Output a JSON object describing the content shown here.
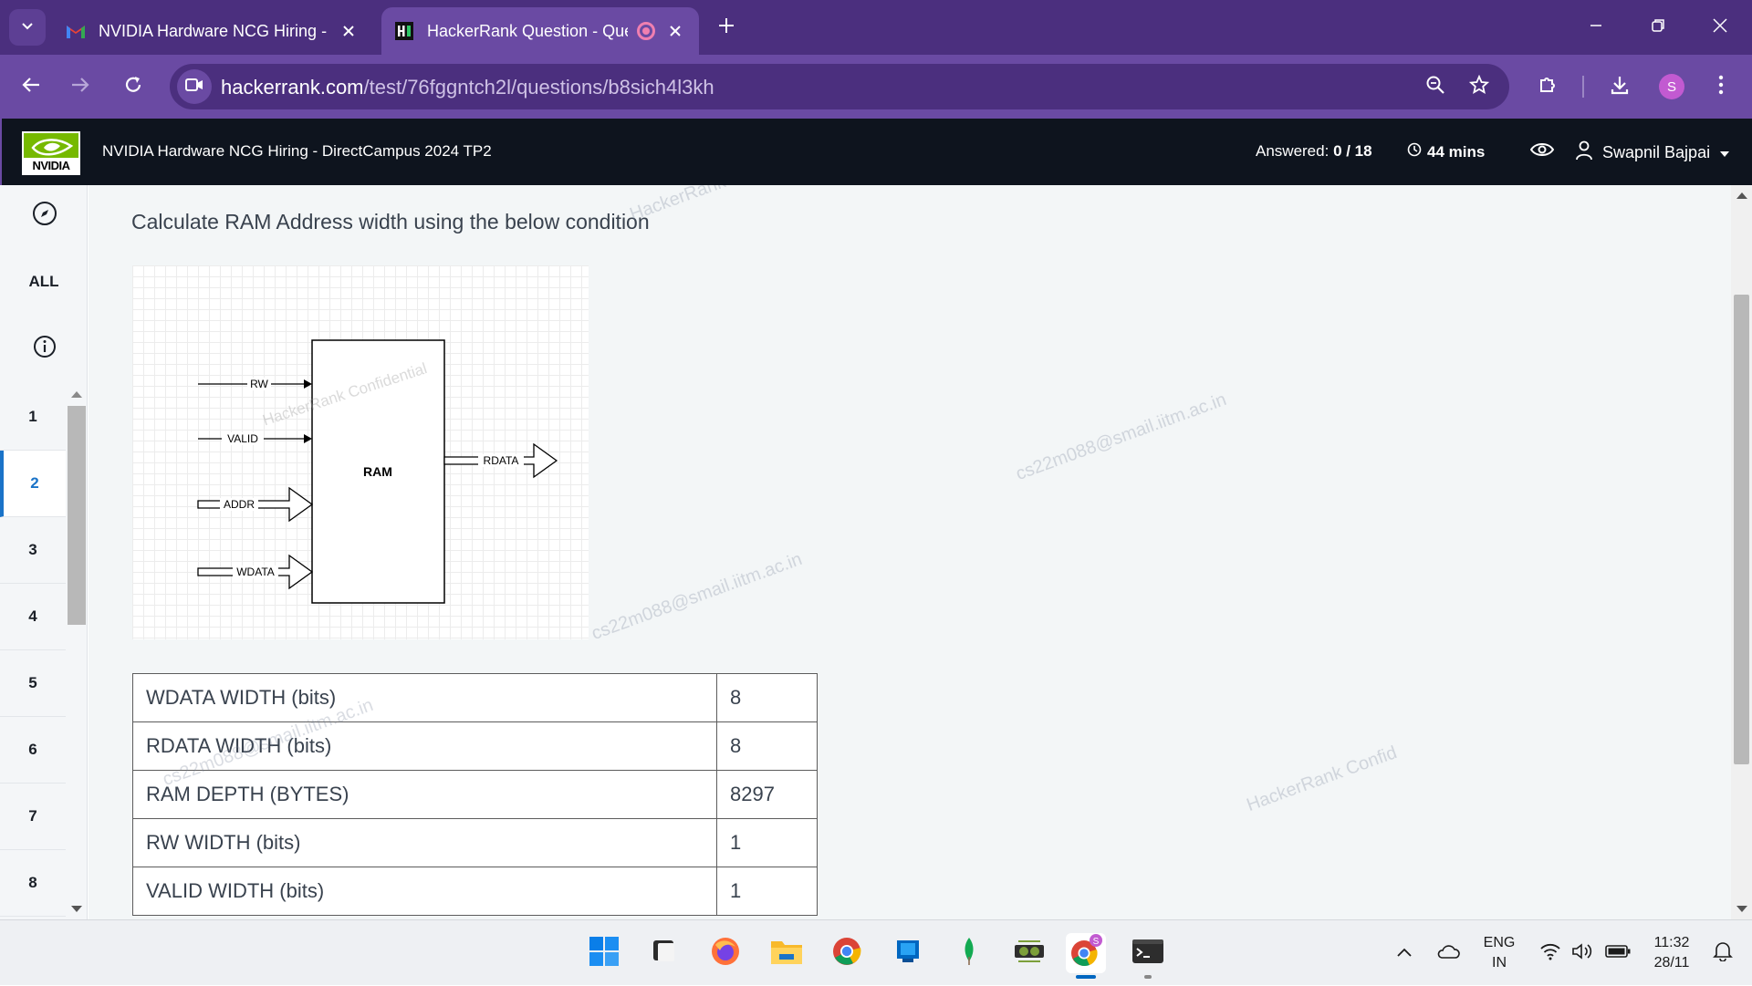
{
  "browser": {
    "tabs": [
      {
        "title": "NVIDIA Hardware NCG Hiring -",
        "favicon": "gmail-icon"
      },
      {
        "title": "HackerRank Question - Que",
        "favicon": "hackerrank-icon",
        "active": true
      }
    ],
    "url_domain": "hackerrank.com",
    "url_path": "/test/76fggntch2l/questions/b8sich4l3kh",
    "profile_initial": "S"
  },
  "header": {
    "logo_text": "NVIDIA",
    "test_title": "NVIDIA Hardware NCG Hiring - DirectCampus 2024 TP2",
    "answered_label": "Answered:",
    "answered_value": "0 / 18",
    "time_left": "44 mins",
    "user_name": "Swapnil Bajpai"
  },
  "sidebar": {
    "all_label": "ALL",
    "questions": [
      "1",
      "2",
      "3",
      "4",
      "5",
      "6",
      "7",
      "8"
    ],
    "active_question": "2"
  },
  "question": {
    "text": "Calculate RAM Address width using the below condition",
    "diagram": {
      "block_label": "RAM",
      "inputs": [
        "RW",
        "VALID",
        "ADDR",
        "WDATA"
      ],
      "outputs": [
        "RDATA"
      ],
      "watermark": "HackerRank Confidential"
    },
    "table": [
      {
        "param": "WDATA WIDTH (bits)",
        "value": "8"
      },
      {
        "param": "RDATA WIDTH (bits)",
        "value": "8"
      },
      {
        "param": "RAM DEPTH (BYTES)",
        "value": "8297"
      },
      {
        "param": "RW WIDTH (bits)",
        "value": "1"
      },
      {
        "param": "VALID WIDTH (bits)",
        "value": "1"
      }
    ]
  },
  "watermarks": {
    "email": "cs22m088@smail.iitm.ac.in",
    "confidential": "HackerRank Confid",
    "top": "HackerRank Co",
    "partial_email": "cs22m088@smail.iitm.ac.in"
  },
  "taskbar": {
    "apps": [
      "windows-start-icon",
      "file-manager-icon",
      "firefox-icon",
      "folder-icon",
      "chrome-icon",
      "store-icon",
      "mongodb-icon",
      "gpu-tool-icon",
      "chrome-profile-icon",
      "terminal-icon"
    ],
    "lang_line1": "ENG",
    "lang_line2": "IN",
    "time": "11:32",
    "date": "28/11"
  },
  "colors": {
    "chrome_frame": "#4b2f7e",
    "chrome_toolbar": "#6a4aa3",
    "hr_header": "#0e141e",
    "nvidia_green": "#76b900",
    "active_question": "#1a73c8"
  }
}
